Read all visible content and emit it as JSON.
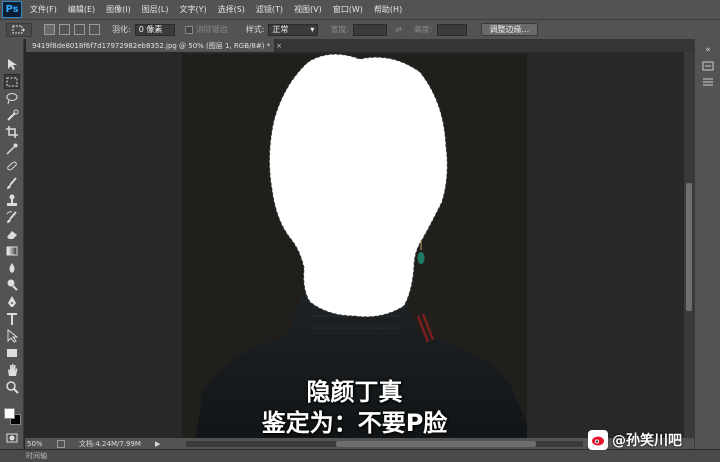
{
  "app": {
    "logo": "Ps"
  },
  "menu": [
    "文件(F)",
    "编辑(E)",
    "图像(I)",
    "图层(L)",
    "文字(Y)",
    "选择(S)",
    "滤镜(T)",
    "视图(V)",
    "窗口(W)",
    "帮助(H)"
  ],
  "options": {
    "feather_label": "羽化:",
    "feather_value": "0 像素",
    "antialias_label": "消除锯齿",
    "style_label": "样式:",
    "style_value": "正常",
    "width_label": "宽度:",
    "height_label": "高度:",
    "refine_button": "调整边缘..."
  },
  "document": {
    "tab_title": "9419f8de8018f6f7d17972982eb8352.jpg @ 50% (图层 1, RGB/8#) *",
    "tab_close": "×"
  },
  "caption": {
    "line1": "隐颜丁真",
    "line2": "鉴定为：不要P脸"
  },
  "status": {
    "zoom": "50%",
    "doc_info": "文档:4.24M/7.99M",
    "arrow": "▶"
  },
  "timeline": {
    "label": "时间轴"
  },
  "watermark": {
    "text": "@孙笑川吧"
  },
  "colors": {
    "ui_dark": "#282828",
    "ui_panel": "#535353",
    "foreground": "#ffffff",
    "background": "#000000"
  },
  "tools": [
    "move-icon",
    "marquee-icon",
    "lasso-icon",
    "quick-select-icon",
    "crop-icon",
    "eyedropper-icon",
    "healing-icon",
    "brush-icon",
    "stamp-icon",
    "history-brush-icon",
    "eraser-icon",
    "gradient-icon",
    "blur-icon",
    "dodge-icon",
    "pen-icon",
    "type-icon",
    "path-select-icon",
    "shape-icon",
    "hand-icon",
    "zoom-icon"
  ]
}
